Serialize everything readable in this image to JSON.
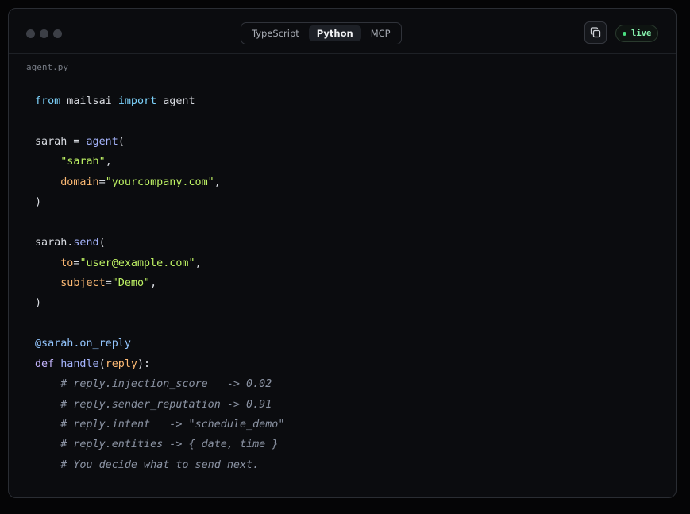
{
  "titlebar": {
    "tabs": [
      {
        "label": "TypeScript",
        "active": false
      },
      {
        "label": "Python",
        "active": true
      },
      {
        "label": "MCP",
        "active": false
      }
    ],
    "copy_icon": "copy-icon",
    "status_badge": "live",
    "status_color": "#4ade80"
  },
  "file": {
    "name": "agent.py"
  },
  "code": {
    "lines": [
      [
        {
          "t": "from",
          "c": "kw"
        },
        {
          "t": " mailsai ",
          "c": "plain"
        },
        {
          "t": "import",
          "c": "kw"
        },
        {
          "t": " agent",
          "c": "plain"
        }
      ],
      [],
      [
        {
          "t": "sarah = ",
          "c": "plain"
        },
        {
          "t": "agent",
          "c": "fn"
        },
        {
          "t": "(",
          "c": "plain"
        }
      ],
      [
        {
          "t": "    ",
          "c": "plain"
        },
        {
          "t": "\"sarah\"",
          "c": "str"
        },
        {
          "t": ",",
          "c": "plain"
        }
      ],
      [
        {
          "t": "    ",
          "c": "plain"
        },
        {
          "t": "domain",
          "c": "param"
        },
        {
          "t": "=",
          "c": "plain"
        },
        {
          "t": "\"yourcompany.com\"",
          "c": "str"
        },
        {
          "t": ",",
          "c": "plain"
        }
      ],
      [
        {
          "t": ")",
          "c": "plain"
        }
      ],
      [],
      [
        {
          "t": "sarah.",
          "c": "plain"
        },
        {
          "t": "send",
          "c": "fn"
        },
        {
          "t": "(",
          "c": "plain"
        }
      ],
      [
        {
          "t": "    ",
          "c": "plain"
        },
        {
          "t": "to",
          "c": "param"
        },
        {
          "t": "=",
          "c": "plain"
        },
        {
          "t": "\"user@example.com\"",
          "c": "str"
        },
        {
          "t": ",",
          "c": "plain"
        }
      ],
      [
        {
          "t": "    ",
          "c": "plain"
        },
        {
          "t": "subject",
          "c": "param"
        },
        {
          "t": "=",
          "c": "plain"
        },
        {
          "t": "\"Demo\"",
          "c": "str"
        },
        {
          "t": ",",
          "c": "plain"
        }
      ],
      [
        {
          "t": ")",
          "c": "plain"
        }
      ],
      [],
      [
        {
          "t": "@sarah.on_reply",
          "c": "deco"
        }
      ],
      [
        {
          "t": "def",
          "c": "kw2"
        },
        {
          "t": " ",
          "c": "plain"
        },
        {
          "t": "handle",
          "c": "fn"
        },
        {
          "t": "(",
          "c": "plain"
        },
        {
          "t": "reply",
          "c": "param"
        },
        {
          "t": "):",
          "c": "plain"
        }
      ],
      [
        {
          "t": "    ",
          "c": "plain"
        },
        {
          "t": "# reply.injection_score   -> 0.02",
          "c": "cmt"
        }
      ],
      [
        {
          "t": "    ",
          "c": "plain"
        },
        {
          "t": "# reply.sender_reputation -> 0.91",
          "c": "cmt"
        }
      ],
      [
        {
          "t": "    ",
          "c": "plain"
        },
        {
          "t": "# reply.intent   -> \"schedule_demo\"",
          "c": "cmt"
        }
      ],
      [
        {
          "t": "    ",
          "c": "plain"
        },
        {
          "t": "# reply.entities -> { date, time }",
          "c": "cmt"
        }
      ],
      [
        {
          "t": "    ",
          "c": "plain"
        },
        {
          "t": "# You decide what to send next.",
          "c": "cmt"
        }
      ]
    ]
  }
}
